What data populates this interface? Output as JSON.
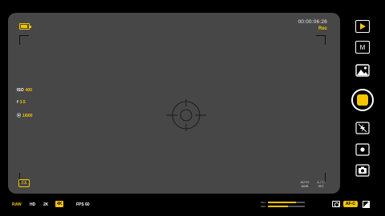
{
  "status": {
    "timecode": "00:00:06:26",
    "rec_label": "Rec"
  },
  "exposure": {
    "iso_label": "ISO",
    "iso_value": "400",
    "aperture_label": "f",
    "aperture_value": "3.5",
    "shutter_label": "⦿",
    "shutter_value": "1/600"
  },
  "overlay": {
    "fx_label": "FX",
    "awb_label_1": "AUTO",
    "awb_label_2": "AWB",
    "iso_auto_label_1": "AUTO",
    "iso_auto_label_2": "ISO"
  },
  "resolutions": {
    "raw": "RAW",
    "hd": "HD",
    "two_k": "2K",
    "four_k": "4K",
    "fps": "FPS 60"
  },
  "meters": {
    "top_label": "CH1",
    "top_level": 0.75,
    "bottom_label": "CH2",
    "bottom_level": 0.55
  },
  "focus_mode": "AF-C",
  "side_controls": {
    "mode_label": "M"
  },
  "colors": {
    "accent": "#f5c400",
    "viewfinder": "#474747",
    "background": "#000000"
  },
  "icons": [
    "battery-icon",
    "play-icon",
    "gallery-icon",
    "flash-off-icon",
    "focus-point-icon",
    "camera-switch-icon",
    "lens-icon",
    "exposure-icon",
    "focus-reticle-icon"
  ]
}
